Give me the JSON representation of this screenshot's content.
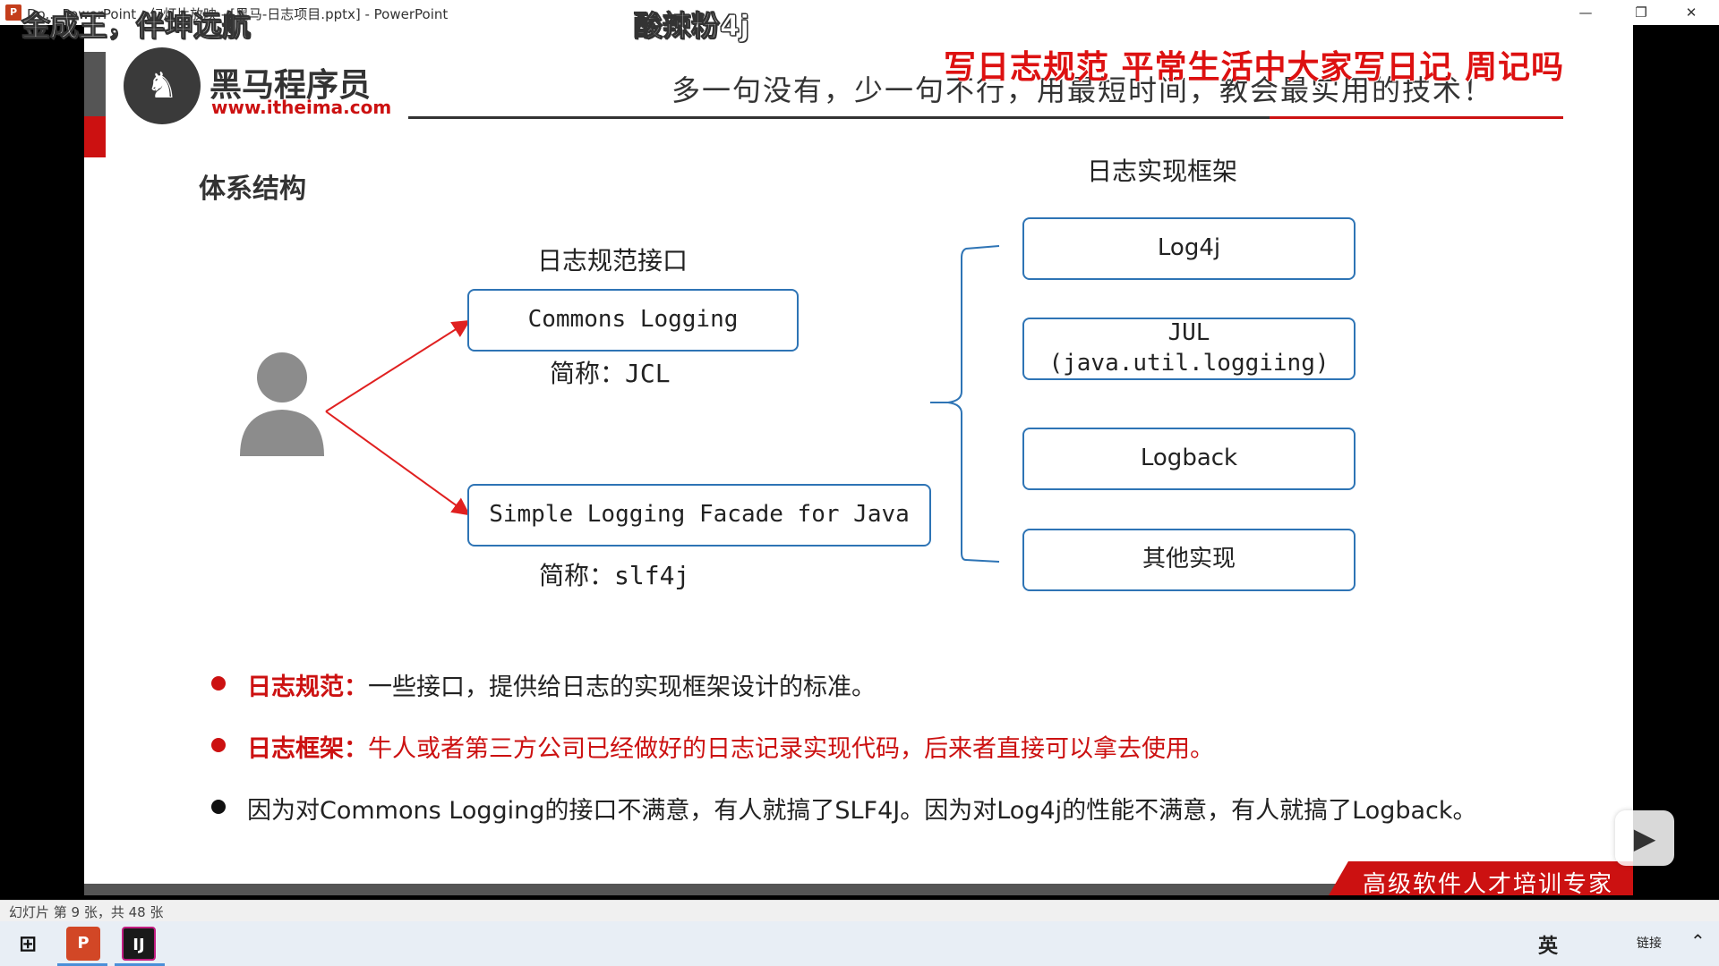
{
  "window": {
    "title": "Do... PowerPoint - 幻灯片放映 - [黑马-日志项目.pptx] - PowerPoint",
    "minimize": "—",
    "restore": "❐",
    "close": "✕"
  },
  "overlays": {
    "top_left": "金成王，伴坤远航",
    "top_mid": "酸辣粉4j",
    "red_caption": "写日志规范  平常生活中大家写日记   周记吗"
  },
  "slide": {
    "logo_name": "黑马程序员",
    "logo_url": "www.itheima.com",
    "motto": "多一句没有，少一句不行，用最短时间，教会最实用的技术！",
    "section_title": "体系结构",
    "interface_heading": "日志规范接口",
    "impl_heading": "日志实现框架",
    "jcl_box": "Commons Logging",
    "jcl_alias": "简称：JCL",
    "slf4j_box": "Simple Logging Facade for Java",
    "slf4j_alias": "简称：slf4j",
    "impls": [
      "Log4j",
      "JUL\n(java.util.loggiing)",
      "Logback",
      "其他实现"
    ],
    "bullets": [
      {
        "label": "日志规范：",
        "text": "一些接口，提供给日志的实现框架设计的标准。"
      },
      {
        "label": "日志框架：",
        "text": "牛人或者第三方公司已经做好的日志记录实现代码，后来者直接可以拿去使用。"
      },
      {
        "label": "",
        "text": "因为对Commons Logging的接口不满意，有人就搞了SLF4J。因为对Log4j的性能不满意，有人就搞了Logback。"
      }
    ],
    "footer_slogan": "高级软件人才培训专家"
  },
  "statusbar": {
    "slide_info": "幻灯片 第 9 张，共 48 张"
  },
  "taskbar": {
    "start_icon": "windows-icon",
    "apps": [
      "P",
      "IJ"
    ],
    "tray_lang": "英",
    "tray_label": "链接"
  },
  "colors": {
    "accent_blue": "#2e74b5",
    "brand_red": "#cc1111",
    "arrow_red": "#e02020"
  }
}
